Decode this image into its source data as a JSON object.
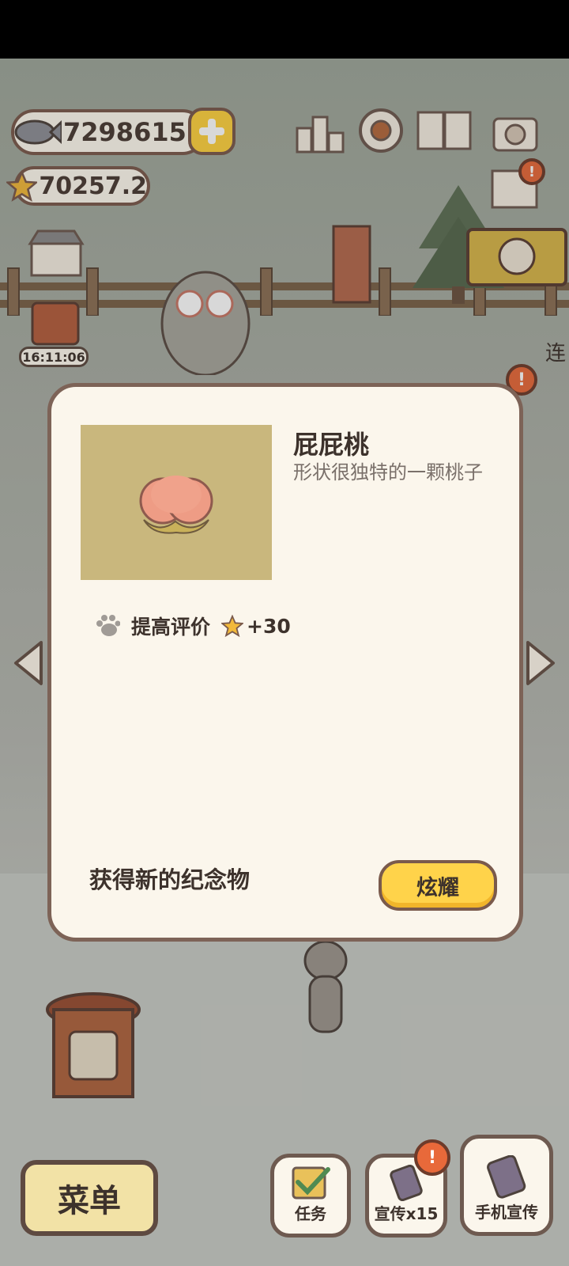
{
  "currency": {
    "fish": "7298615",
    "stars": "70257.2"
  },
  "timer": "16:11:06",
  "side_text": "连",
  "dialog": {
    "item_name": "屁屁桃",
    "item_desc": "形状很独特的一颗桃子",
    "bonus_label": "提高评价",
    "bonus_value": "+30",
    "obtain_text": "获得新的纪念物",
    "show_button": "炫耀"
  },
  "bottom": {
    "menu": "菜单",
    "tasks": "任务",
    "promo": "宣传x15",
    "phone_promo": "手机宣传"
  },
  "colors": {
    "panel_bg": "#fbf6ec",
    "panel_border": "#7d6357",
    "accent_yellow": "#ffd34a",
    "badge_orange": "#e8693a"
  }
}
